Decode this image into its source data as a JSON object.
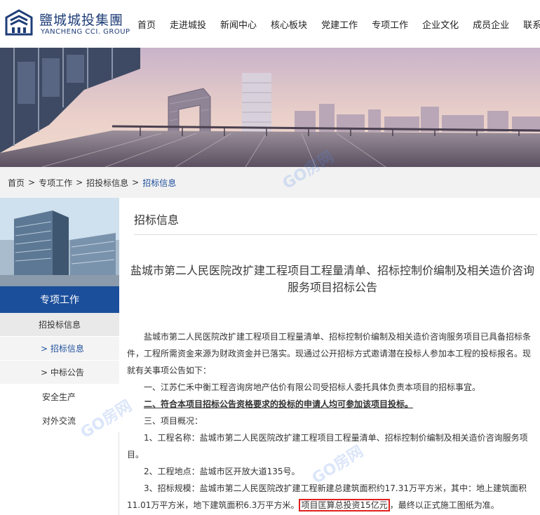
{
  "header": {
    "logo_cn": "鹽城城投集團",
    "logo_en": "YANCHENG CCI. GROUP",
    "nav": [
      "首页",
      "走进城投",
      "新闻中心",
      "核心板块",
      "党建工作",
      "专项工作",
      "企业文化",
      "成员企业",
      "联系我们"
    ]
  },
  "breadcrumb": {
    "items": [
      "首页",
      "专项工作",
      "招投标信息"
    ],
    "current": "招标信息",
    "separator": ">"
  },
  "sidebar": {
    "title": "专项工作",
    "menu": {
      "group_label": "招投标信息",
      "sub_active": "> 招标信息",
      "sub_other": "> 中标公告",
      "safety": "安全生产",
      "exchange": "对外交流"
    }
  },
  "main": {
    "section_title": "招标信息",
    "article_title": "盐城市第二人民医院改扩建工程项目工程量清单、招标控制价编制及相关造价咨询服务项目招标公告",
    "intro": "盐城市第二人民医院改扩建工程项目工程量清单、招标控制价编制及相关造价咨询服务项目已具备招标条件，工程所需资金来源为财政资金并已落实。现通过公开招标方式邀请潜在投标人参加本工程的投标报名。现就有关事项公告如下：",
    "item1": "一、江苏仁禾中衡工程咨询房地产估价有限公司受招标人委托具体负责本项目的招标事宜。",
    "item2": "二、符合本项目招标公告资格要求的投标的申请人均可参加该项目投标。",
    "item3": "三、项目概况：",
    "sub1": "1、工程名称：盐城市第二人民医院改扩建工程项目工程量清单、招标控制价编制及相关造价咨询服务项目。",
    "sub2": "2、工程地点：盐城市区开放大道135号。",
    "sub3_before": "3、招标规模：盐城市第二人民医院改扩建工程新建总建筑面积约17.31万平方米，其中：地上建筑面积11.01万平方米，地下建筑面积6.3万平方米。",
    "sub3_highlight": "项目匡算总投资15亿元",
    "sub3_after": "，最终以正式施工图纸为准。"
  },
  "watermark": "GO房网",
  "colors": {
    "brand_blue": "#1c4f9b",
    "logo_blue": "#1f3e78",
    "highlight_red": "#e02020"
  }
}
